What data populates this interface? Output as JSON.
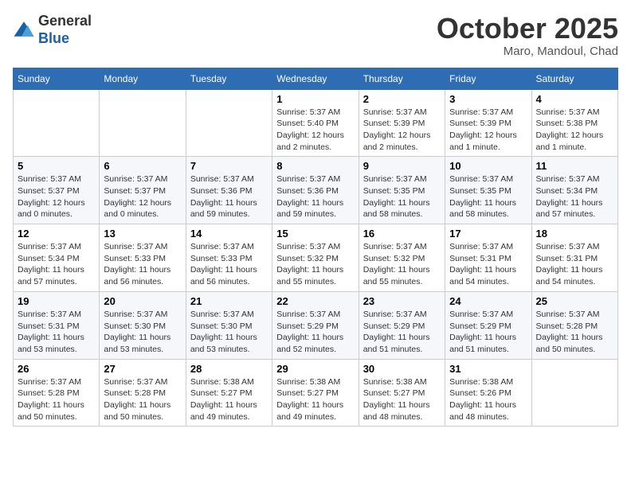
{
  "header": {
    "logo_general": "General",
    "logo_blue": "Blue",
    "month_title": "October 2025",
    "subtitle": "Maro, Mandoul, Chad"
  },
  "weekdays": [
    "Sunday",
    "Monday",
    "Tuesday",
    "Wednesday",
    "Thursday",
    "Friday",
    "Saturday"
  ],
  "weeks": [
    [
      {
        "day": "",
        "info": ""
      },
      {
        "day": "",
        "info": ""
      },
      {
        "day": "",
        "info": ""
      },
      {
        "day": "1",
        "info": "Sunrise: 5:37 AM\nSunset: 5:40 PM\nDaylight: 12 hours\nand 2 minutes."
      },
      {
        "day": "2",
        "info": "Sunrise: 5:37 AM\nSunset: 5:39 PM\nDaylight: 12 hours\nand 2 minutes."
      },
      {
        "day": "3",
        "info": "Sunrise: 5:37 AM\nSunset: 5:39 PM\nDaylight: 12 hours\nand 1 minute."
      },
      {
        "day": "4",
        "info": "Sunrise: 5:37 AM\nSunset: 5:38 PM\nDaylight: 12 hours\nand 1 minute."
      }
    ],
    [
      {
        "day": "5",
        "info": "Sunrise: 5:37 AM\nSunset: 5:37 PM\nDaylight: 12 hours\nand 0 minutes."
      },
      {
        "day": "6",
        "info": "Sunrise: 5:37 AM\nSunset: 5:37 PM\nDaylight: 12 hours\nand 0 minutes."
      },
      {
        "day": "7",
        "info": "Sunrise: 5:37 AM\nSunset: 5:36 PM\nDaylight: 11 hours\nand 59 minutes."
      },
      {
        "day": "8",
        "info": "Sunrise: 5:37 AM\nSunset: 5:36 PM\nDaylight: 11 hours\nand 59 minutes."
      },
      {
        "day": "9",
        "info": "Sunrise: 5:37 AM\nSunset: 5:35 PM\nDaylight: 11 hours\nand 58 minutes."
      },
      {
        "day": "10",
        "info": "Sunrise: 5:37 AM\nSunset: 5:35 PM\nDaylight: 11 hours\nand 58 minutes."
      },
      {
        "day": "11",
        "info": "Sunrise: 5:37 AM\nSunset: 5:34 PM\nDaylight: 11 hours\nand 57 minutes."
      }
    ],
    [
      {
        "day": "12",
        "info": "Sunrise: 5:37 AM\nSunset: 5:34 PM\nDaylight: 11 hours\nand 57 minutes."
      },
      {
        "day": "13",
        "info": "Sunrise: 5:37 AM\nSunset: 5:33 PM\nDaylight: 11 hours\nand 56 minutes."
      },
      {
        "day": "14",
        "info": "Sunrise: 5:37 AM\nSunset: 5:33 PM\nDaylight: 11 hours\nand 56 minutes."
      },
      {
        "day": "15",
        "info": "Sunrise: 5:37 AM\nSunset: 5:32 PM\nDaylight: 11 hours\nand 55 minutes."
      },
      {
        "day": "16",
        "info": "Sunrise: 5:37 AM\nSunset: 5:32 PM\nDaylight: 11 hours\nand 55 minutes."
      },
      {
        "day": "17",
        "info": "Sunrise: 5:37 AM\nSunset: 5:31 PM\nDaylight: 11 hours\nand 54 minutes."
      },
      {
        "day": "18",
        "info": "Sunrise: 5:37 AM\nSunset: 5:31 PM\nDaylight: 11 hours\nand 54 minutes."
      }
    ],
    [
      {
        "day": "19",
        "info": "Sunrise: 5:37 AM\nSunset: 5:31 PM\nDaylight: 11 hours\nand 53 minutes."
      },
      {
        "day": "20",
        "info": "Sunrise: 5:37 AM\nSunset: 5:30 PM\nDaylight: 11 hours\nand 53 minutes."
      },
      {
        "day": "21",
        "info": "Sunrise: 5:37 AM\nSunset: 5:30 PM\nDaylight: 11 hours\nand 53 minutes."
      },
      {
        "day": "22",
        "info": "Sunrise: 5:37 AM\nSunset: 5:29 PM\nDaylight: 11 hours\nand 52 minutes."
      },
      {
        "day": "23",
        "info": "Sunrise: 5:37 AM\nSunset: 5:29 PM\nDaylight: 11 hours\nand 51 minutes."
      },
      {
        "day": "24",
        "info": "Sunrise: 5:37 AM\nSunset: 5:29 PM\nDaylight: 11 hours\nand 51 minutes."
      },
      {
        "day": "25",
        "info": "Sunrise: 5:37 AM\nSunset: 5:28 PM\nDaylight: 11 hours\nand 50 minutes."
      }
    ],
    [
      {
        "day": "26",
        "info": "Sunrise: 5:37 AM\nSunset: 5:28 PM\nDaylight: 11 hours\nand 50 minutes."
      },
      {
        "day": "27",
        "info": "Sunrise: 5:37 AM\nSunset: 5:28 PM\nDaylight: 11 hours\nand 50 minutes."
      },
      {
        "day": "28",
        "info": "Sunrise: 5:38 AM\nSunset: 5:27 PM\nDaylight: 11 hours\nand 49 minutes."
      },
      {
        "day": "29",
        "info": "Sunrise: 5:38 AM\nSunset: 5:27 PM\nDaylight: 11 hours\nand 49 minutes."
      },
      {
        "day": "30",
        "info": "Sunrise: 5:38 AM\nSunset: 5:27 PM\nDaylight: 11 hours\nand 48 minutes."
      },
      {
        "day": "31",
        "info": "Sunrise: 5:38 AM\nSunset: 5:26 PM\nDaylight: 11 hours\nand 48 minutes."
      },
      {
        "day": "",
        "info": ""
      }
    ]
  ]
}
